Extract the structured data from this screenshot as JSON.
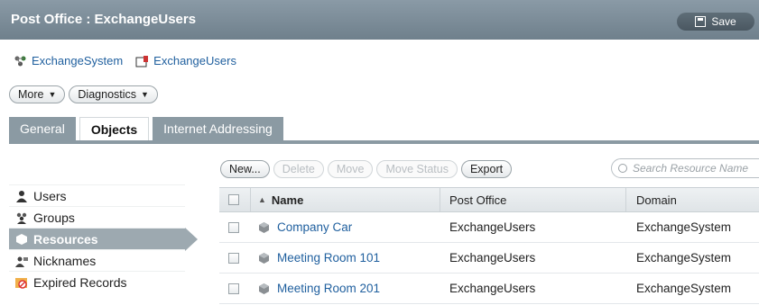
{
  "header": {
    "title": "Post Office : ExchangeUsers",
    "save_label": "Save"
  },
  "breadcrumb": {
    "items": [
      "ExchangeSystem",
      "ExchangeUsers"
    ]
  },
  "dropdowns": {
    "more": "More",
    "diagnostics": "Diagnostics"
  },
  "tabs": [
    "General",
    "Objects",
    "Internet Addressing"
  ],
  "sidebar": {
    "items": [
      {
        "label": "Users"
      },
      {
        "label": "Groups"
      },
      {
        "label": "Resources"
      },
      {
        "label": "Nicknames"
      },
      {
        "label": "Expired Records"
      }
    ]
  },
  "toolbar": {
    "new": "New...",
    "delete": "Delete",
    "move": "Move",
    "move_status": "Move Status",
    "export": "Export"
  },
  "search": {
    "placeholder": "Search Resource Name"
  },
  "table": {
    "columns": [
      "Name",
      "Post Office",
      "Domain"
    ],
    "rows": [
      {
        "name": "Company Car",
        "post_office": "ExchangeUsers",
        "domain": "ExchangeSystem"
      },
      {
        "name": "Meeting Room 101",
        "post_office": "ExchangeUsers",
        "domain": "ExchangeSystem"
      },
      {
        "name": "Meeting Room 201",
        "post_office": "ExchangeUsers",
        "domain": "ExchangeSystem"
      }
    ]
  },
  "colors": {
    "header_bg": "#7c8c97",
    "link": "#1f5f9e",
    "active_sidebar": "#9da9b0",
    "tab_inactive": "#8b9aa3"
  }
}
